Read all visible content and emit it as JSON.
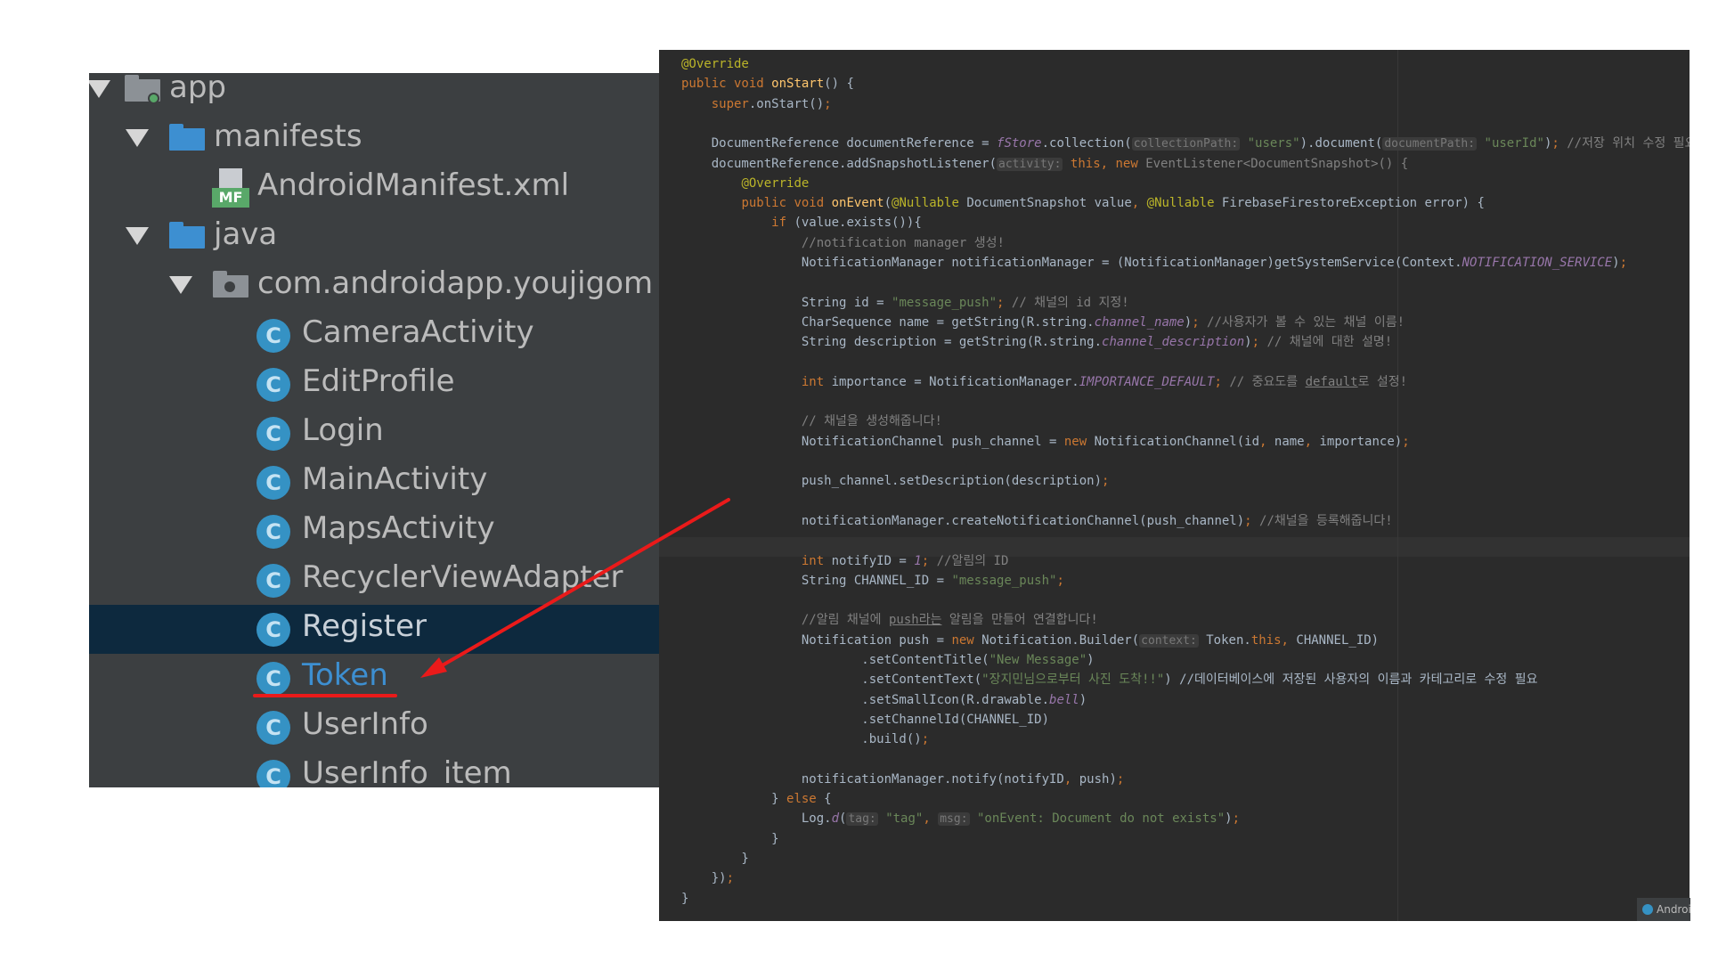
{
  "project_tree": {
    "items": [
      {
        "label": "app",
        "kind": "module"
      },
      {
        "label": "manifests",
        "kind": "folder"
      },
      {
        "label": "AndroidManifest.xml",
        "kind": "manifest",
        "badge": "MF"
      },
      {
        "label": "java",
        "kind": "folder"
      },
      {
        "label": "com.androidapp.youjigom",
        "kind": "package"
      },
      {
        "label": "CameraActivity",
        "kind": "class",
        "icon_letter": "C"
      },
      {
        "label": "EditProfile",
        "kind": "class",
        "icon_letter": "C"
      },
      {
        "label": "Login",
        "kind": "class",
        "icon_letter": "C"
      },
      {
        "label": "MainActivity",
        "kind": "class",
        "icon_letter": "C"
      },
      {
        "label": "MapsActivity",
        "kind": "class",
        "icon_letter": "C"
      },
      {
        "label": "RecyclerViewAdapter",
        "kind": "class",
        "icon_letter": "C"
      },
      {
        "label": "Register",
        "kind": "class",
        "icon_letter": "C",
        "selected": true
      },
      {
        "label": "Token",
        "kind": "class",
        "icon_letter": "C",
        "highlighted": true
      },
      {
        "label": "UserInfo",
        "kind": "class",
        "icon_letter": "C"
      },
      {
        "label": "UserInfo_item",
        "kind": "class",
        "icon_letter": "C"
      }
    ]
  },
  "code_lines": [
    [
      [
        "@Override",
        "an"
      ]
    ],
    [
      [
        "public void ",
        "kw"
      ],
      [
        "onStart",
        "fn"
      ],
      [
        "() {",
        ""
      ]
    ],
    [
      [
        "    ",
        ""
      ],
      [
        "super",
        "kw"
      ],
      [
        ".onStart()",
        ""
      ],
      [
        ";",
        "kw"
      ]
    ],
    [],
    [
      [
        "    DocumentReference documentReference = ",
        ""
      ],
      [
        "fStore",
        "fl"
      ],
      [
        ".collection(",
        ""
      ],
      [
        "collectionPath:",
        "ph"
      ],
      [
        " ",
        ""
      ],
      [
        "\"users\"",
        "st"
      ],
      [
        ").document(",
        ""
      ],
      [
        "documentPath:",
        "ph"
      ],
      [
        " ",
        ""
      ],
      [
        "\"userId\"",
        "st"
      ],
      [
        ")",
        ""
      ],
      [
        ";",
        "kw"
      ],
      [
        " //저장 위치 수정 필요",
        "cm"
      ]
    ],
    [
      [
        "    documentReference.addSnapshotListener(",
        ""
      ],
      [
        "activity:",
        "ph"
      ],
      [
        " ",
        ""
      ],
      [
        "this",
        "kw"
      ],
      [
        ", ",
        "kw"
      ],
      [
        "new ",
        "kw"
      ],
      [
        "EventListener<DocumentSnapshot>() {",
        "cm"
      ]
    ],
    [
      [
        "        ",
        ""
      ],
      [
        "@Override",
        "an"
      ]
    ],
    [
      [
        "        ",
        ""
      ],
      [
        "public void ",
        "kw"
      ],
      [
        "onEvent",
        "fn"
      ],
      [
        "(",
        ""
      ],
      [
        "@Nullable",
        "an"
      ],
      [
        " DocumentSnapshot value",
        ""
      ],
      [
        ", ",
        "kw"
      ],
      [
        "@Nullable",
        "an"
      ],
      [
        " FirebaseFirestoreException error) {",
        ""
      ]
    ],
    [
      [
        "            ",
        ""
      ],
      [
        "if ",
        "kw"
      ],
      [
        "(value.exists()){",
        ""
      ]
    ],
    [
      [
        "                //notification manager 생성!",
        "cm"
      ]
    ],
    [
      [
        "                NotificationManager notificationManager = (NotificationManager)getSystemService(Context.",
        ""
      ],
      [
        "NOTIFICATION_SERVICE",
        "fl"
      ],
      [
        ")",
        ""
      ],
      [
        ";",
        "kw"
      ]
    ],
    [],
    [
      [
        "                String id = ",
        ""
      ],
      [
        "\"message_push\"",
        "st"
      ],
      [
        ";",
        "kw"
      ],
      [
        " // 채널의 id 지정!",
        "cm"
      ]
    ],
    [
      [
        "                CharSequence name = getString(R.string.",
        ""
      ],
      [
        "channel_name",
        "fl"
      ],
      [
        ")",
        ""
      ],
      [
        ";",
        "kw"
      ],
      [
        " //사용자가 볼 수 있는 채널 이름!",
        "cm"
      ]
    ],
    [
      [
        "                String description = getString(R.string.",
        ""
      ],
      [
        "channel_description",
        "fl"
      ],
      [
        ")",
        ""
      ],
      [
        ";",
        "kw"
      ],
      [
        " // 채널에 대한 설명!",
        "cm"
      ]
    ],
    [],
    [
      [
        "                ",
        ""
      ],
      [
        "int ",
        "kw"
      ],
      [
        "importance = NotificationManager.",
        ""
      ],
      [
        "IMPORTANCE_DEFAULT",
        "fl"
      ],
      [
        ";",
        "kw"
      ],
      [
        " // 중요도를 ",
        "cm"
      ],
      [
        "default",
        "cm ul"
      ],
      [
        "로 설정!",
        "cm"
      ]
    ],
    [],
    [
      [
        "                // 채널을 생성해줍니다!",
        "cm"
      ]
    ],
    [
      [
        "                NotificationChannel push_channel = ",
        ""
      ],
      [
        "new ",
        "kw"
      ],
      [
        "NotificationChannel(id",
        ""
      ],
      [
        ", ",
        "kw"
      ],
      [
        "name",
        ""
      ],
      [
        ", ",
        "kw"
      ],
      [
        "importance)",
        ""
      ],
      [
        ";",
        "kw"
      ]
    ],
    [],
    [
      [
        "                push_channel.setDescription(description)",
        ""
      ],
      [
        ";",
        "kw"
      ]
    ],
    [],
    [
      [
        "                notificationManager.createNotificationChannel(push_channel)",
        ""
      ],
      [
        ";",
        "kw"
      ],
      [
        " //채널을 등록해줍니다!",
        "cm"
      ]
    ],
    [],
    [
      [
        "                ",
        ""
      ],
      [
        "int ",
        "kw"
      ],
      [
        "notifyID = ",
        ""
      ],
      [
        "1",
        "fl"
      ],
      [
        ";",
        "kw"
      ],
      [
        " //알림의 ID",
        "cm"
      ]
    ],
    [
      [
        "                String CHANNEL_ID = ",
        ""
      ],
      [
        "\"message_push\"",
        "st"
      ],
      [
        ";",
        "kw"
      ]
    ],
    [],
    [
      [
        "                //알림 채널에 ",
        "cm"
      ],
      [
        "push라는",
        "cm ul"
      ],
      [
        " 알림을 만들어 연결합니다!",
        "cm"
      ]
    ],
    [
      [
        "                Notification push = ",
        ""
      ],
      [
        "new ",
        "kw"
      ],
      [
        "Notification.Builder(",
        ""
      ],
      [
        "context:",
        "ph"
      ],
      [
        " Token.",
        ""
      ],
      [
        "this",
        "kw"
      ],
      [
        ", ",
        "kw"
      ],
      [
        "CHANNEL_ID)",
        ""
      ]
    ],
    [
      [
        "                        .setContentTitle(",
        ""
      ],
      [
        "\"New Message\"",
        "st"
      ],
      [
        ")",
        ""
      ]
    ],
    [
      [
        "                        .setContentText(",
        ""
      ],
      [
        "\"장지민님으로부터 사진 도착!!\"",
        "st"
      ],
      [
        ") //데이터베이스에 저장된 사용자의 이름과 카테고리로 수정 필요",
        ""
      ]
    ],
    [
      [
        "                        .setSmallIcon(R.drawable.",
        ""
      ],
      [
        "bell",
        "fl"
      ],
      [
        ")",
        ""
      ]
    ],
    [
      [
        "                        .setChannelId(CHANNEL_ID)",
        ""
      ]
    ],
    [
      [
        "                        .build()",
        ""
      ],
      [
        ";",
        "kw"
      ]
    ],
    [],
    [
      [
        "                notificationManager.notify(notifyID",
        ""
      ],
      [
        ", ",
        "kw"
      ],
      [
        "push)",
        ""
      ],
      [
        ";",
        "kw"
      ]
    ],
    [
      [
        "            } ",
        ""
      ],
      [
        "else ",
        "kw"
      ],
      [
        "{",
        ""
      ]
    ],
    [
      [
        "                Log.",
        ""
      ],
      [
        "d",
        "fl"
      ],
      [
        "(",
        ""
      ],
      [
        "tag:",
        "ph"
      ],
      [
        " ",
        ""
      ],
      [
        "\"tag\"",
        "st"
      ],
      [
        ", ",
        "kw"
      ],
      [
        "msg:",
        "ph"
      ],
      [
        " ",
        ""
      ],
      [
        "\"onEvent: Document do not exists\"",
        "st"
      ],
      [
        ")",
        ""
      ],
      [
        ";",
        "kw"
      ]
    ],
    [
      [
        "            }",
        ""
      ]
    ],
    [
      [
        "        }",
        ""
      ]
    ],
    [
      [
        "    })",
        ""
      ],
      [
        ";",
        "kw"
      ]
    ],
    [
      [
        "}",
        ""
      ]
    ]
  ],
  "notification": {
    "text": "Android"
  }
}
